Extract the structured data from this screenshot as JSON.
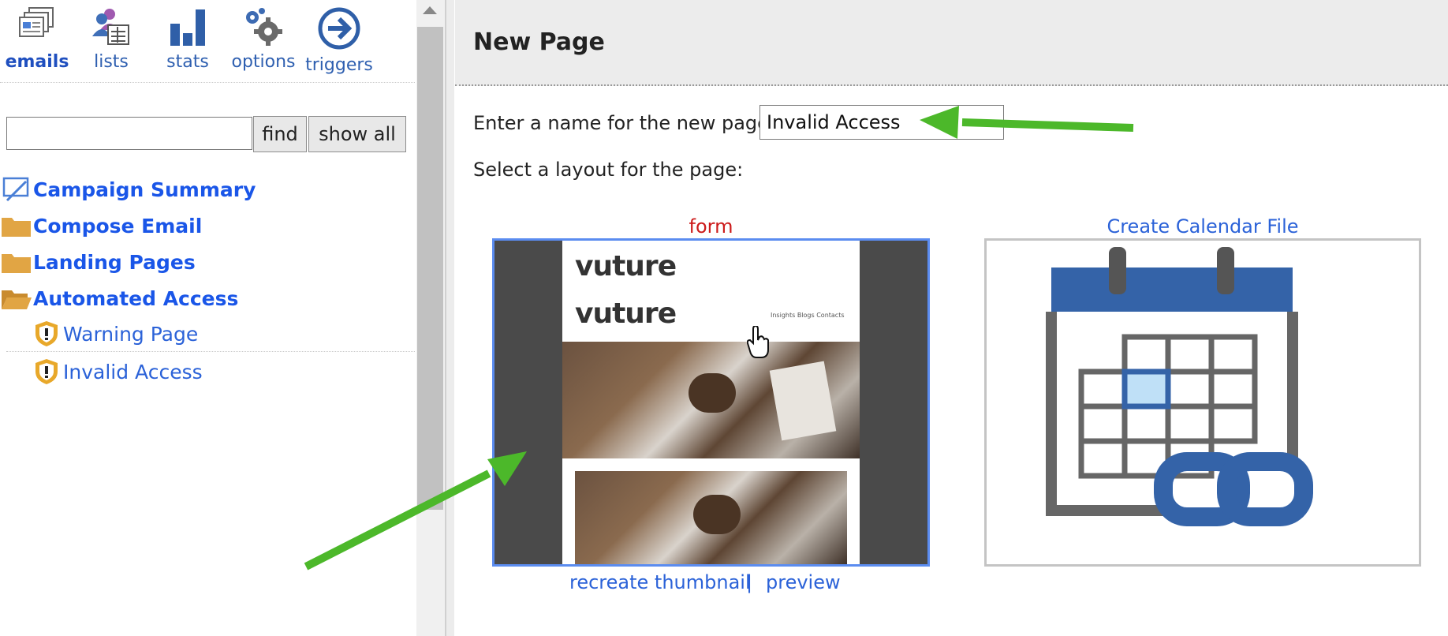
{
  "toolbar": {
    "items": [
      {
        "label": "emails",
        "icon": "emails-icon"
      },
      {
        "label": "lists",
        "icon": "lists-icon"
      },
      {
        "label": "stats",
        "icon": "stats-icon"
      },
      {
        "label": "options",
        "icon": "options-icon"
      },
      {
        "label": "triggers",
        "icon": "triggers-icon"
      }
    ]
  },
  "search": {
    "value": "",
    "find_label": "find",
    "show_all_label": "show all"
  },
  "tree": {
    "items": [
      {
        "label": "Campaign Summary",
        "icon": "campaign-summary-icon"
      },
      {
        "label": "Compose Email",
        "icon": "folder-icon"
      },
      {
        "label": "Landing Pages",
        "icon": "folder-icon"
      },
      {
        "label": "Automated Access",
        "icon": "folder-open-icon"
      }
    ],
    "subitems": [
      {
        "label": "Warning Page",
        "icon": "warning-shield-icon"
      },
      {
        "label": "Invalid Access",
        "icon": "warning-shield-icon"
      }
    ]
  },
  "main": {
    "title": "New Page",
    "name_prompt": "Enter a name for the new page:",
    "name_value": "Invalid Access",
    "layout_prompt": "Select a layout for the page:",
    "layouts": [
      {
        "title": "form",
        "title_color": "#cc1a1a"
      },
      {
        "title": "Create Calendar File",
        "title_color": "#2b62d8"
      }
    ],
    "recreate_label": "recreate thumbnail",
    "separator": "|",
    "preview_label": "preview",
    "thumb_brand": "vuture",
    "thumb_nav": "Insights  Blogs  Contacts"
  },
  "colors": {
    "accent": "#1a56e8",
    "arrow": "#4cb82a",
    "calendar_blue": "#3463a8",
    "selected_border": "#5b8cf0"
  }
}
